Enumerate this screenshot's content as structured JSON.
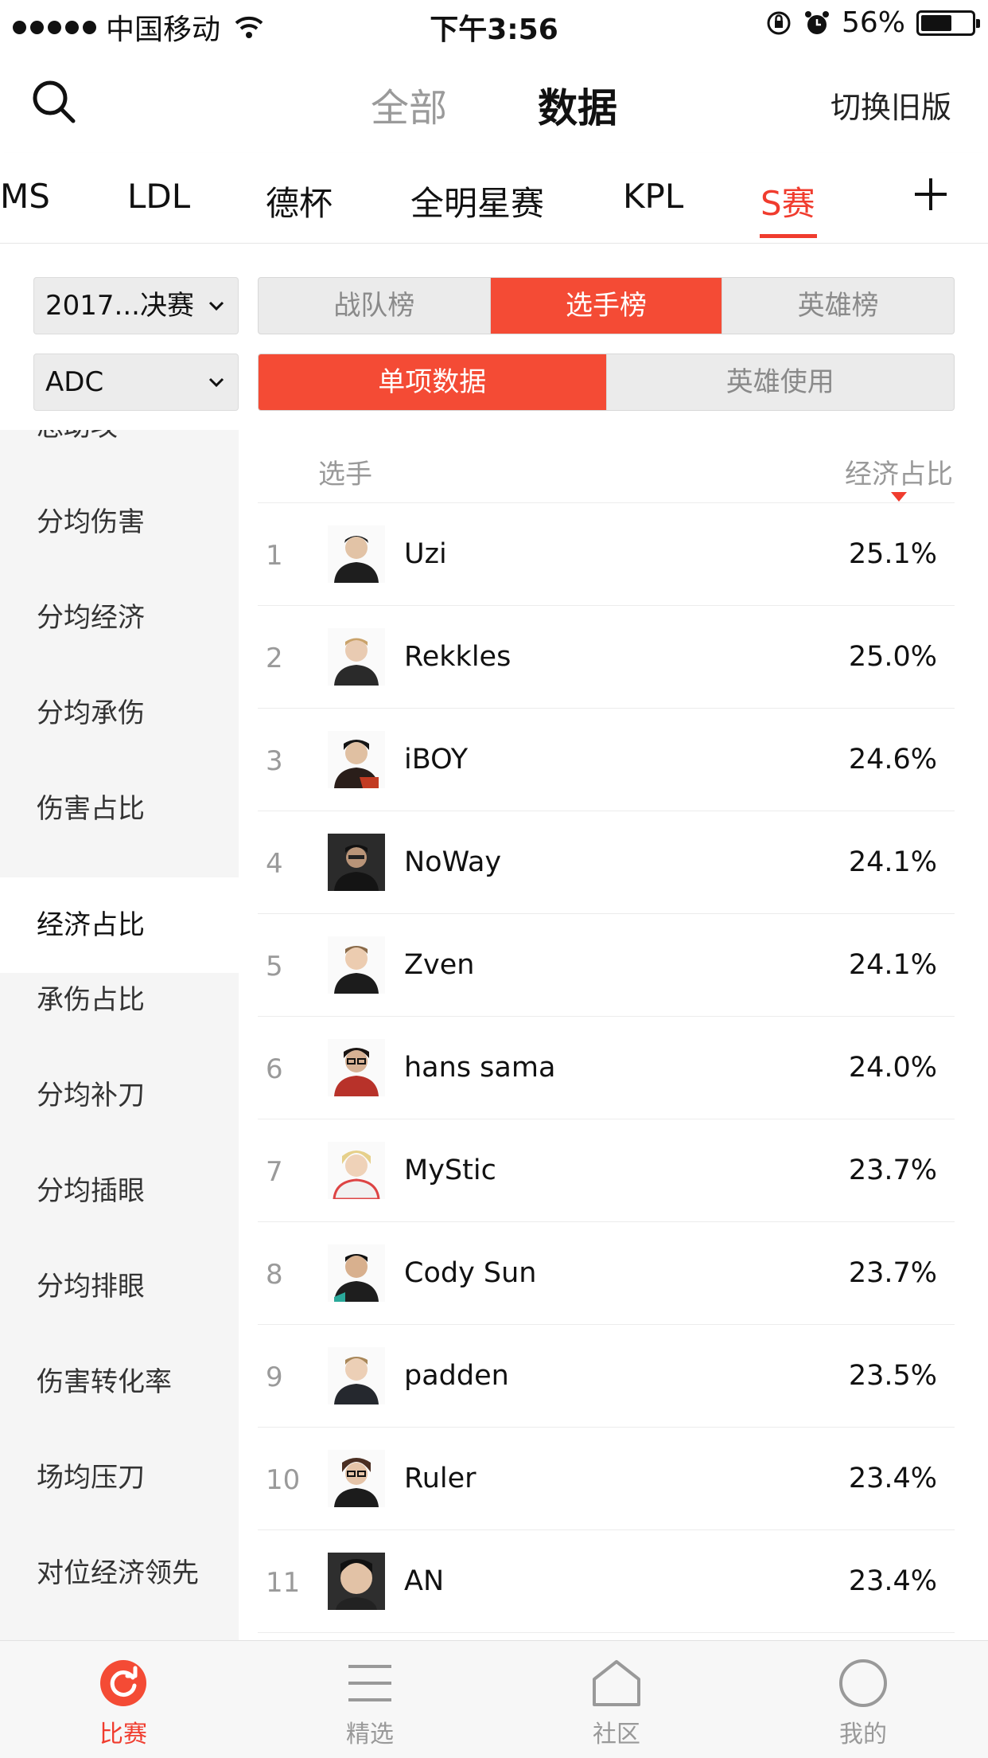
{
  "status_bar": {
    "carrier": "中国移动",
    "time": "下午3:56",
    "battery": "56%",
    "battery_level": 0.56
  },
  "header": {
    "tab_all": "全部",
    "tab_data": "数据",
    "switch_old": "切换旧版"
  },
  "league_tabs": [
    {
      "label": "MS"
    },
    {
      "label": "LDL"
    },
    {
      "label": "德杯"
    },
    {
      "label": "全明星赛"
    },
    {
      "label": "KPL"
    },
    {
      "label": "S赛"
    }
  ],
  "filters": {
    "season": "2017...决赛",
    "position": "ADC",
    "rank_tabs": [
      "战队榜",
      "选手榜",
      "英雄榜"
    ],
    "data_tabs": [
      "单项数据",
      "英雄使用"
    ]
  },
  "sidebar": {
    "items": [
      {
        "label": "总助攻"
      },
      {
        "label": "分均伤害"
      },
      {
        "label": "分均经济"
      },
      {
        "label": "分均承伤"
      },
      {
        "label": "伤害占比"
      },
      {
        "label": "经济占比"
      },
      {
        "label": "承伤占比"
      },
      {
        "label": "分均补刀"
      },
      {
        "label": "分均插眼"
      },
      {
        "label": "分均排眼"
      },
      {
        "label": "伤害转化率"
      },
      {
        "label": "场均压刀"
      },
      {
        "label": "对位经济领先"
      }
    ]
  },
  "table": {
    "col_player": "选手",
    "col_stat": "经济占比",
    "rows": [
      {
        "rank": "1",
        "name": "Uzi",
        "value": "25.1%"
      },
      {
        "rank": "2",
        "name": "Rekkles",
        "value": "25.0%"
      },
      {
        "rank": "3",
        "name": "iBOY",
        "value": "24.6%"
      },
      {
        "rank": "4",
        "name": "NoWay",
        "value": "24.1%"
      },
      {
        "rank": "5",
        "name": "Zven",
        "value": "24.1%"
      },
      {
        "rank": "6",
        "name": "hans sama",
        "value": "24.0%"
      },
      {
        "rank": "7",
        "name": "MyStic",
        "value": "23.7%"
      },
      {
        "rank": "8",
        "name": "Cody Sun",
        "value": "23.7%"
      },
      {
        "rank": "9",
        "name": "padden",
        "value": "23.5%"
      },
      {
        "rank": "10",
        "name": "Ruler",
        "value": "23.4%"
      },
      {
        "rank": "11",
        "name": "AN",
        "value": "23.4%"
      }
    ]
  },
  "tabbar": {
    "items": [
      {
        "label": "比赛",
        "icon": "match-refresh-icon"
      },
      {
        "label": "精选",
        "icon": "menu-lines-icon"
      },
      {
        "label": "社区",
        "icon": "house-icon"
      },
      {
        "label": "我的",
        "icon": "profile-circle-icon"
      }
    ]
  },
  "colors": {
    "accent": "#f03c2e",
    "segment_active": "#f44b35",
    "sidebar_bg": "#f5f5f5"
  }
}
